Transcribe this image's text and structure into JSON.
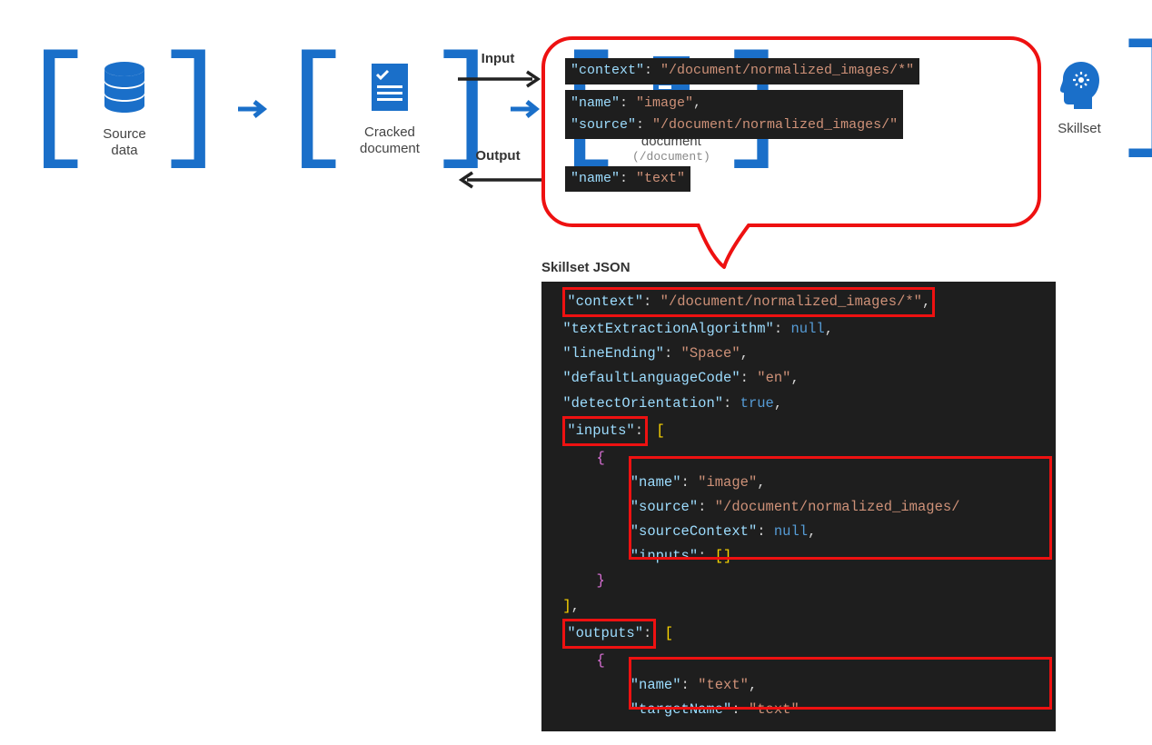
{
  "pipeline": {
    "source": {
      "label": "Source\ndata"
    },
    "cracked": {
      "label": "Cracked\ndocument"
    },
    "enriched": {
      "label": "Enriched\ndocument",
      "sublabel": "(/document)"
    },
    "skillset": {
      "label": "Skillset"
    }
  },
  "io": {
    "input": "Input",
    "output": "Output"
  },
  "bubble": {
    "line1": "\"context\": \"/document/normalized_images/*\"",
    "line2a": "\"name\": \"image\",",
    "line2b": "\"source\": \"/document/normalized_images/\"",
    "line3": "\"name\": \"text\""
  },
  "jsonTitle": "Skillset JSON",
  "json": {
    "context_key": "\"context\"",
    "context_val": "\"/document/normalized_images/*\"",
    "tea_key": "\"textExtractionAlgorithm\"",
    "tea_val": "null",
    "le_key": "\"lineEnding\"",
    "le_val": "\"Space\"",
    "dlc_key": "\"defaultLanguageCode\"",
    "dlc_val": "\"en\"",
    "do_key": "\"detectOrientation\"",
    "do_val": "true",
    "inputs_key": "\"inputs\"",
    "in_name_key": "\"name\"",
    "in_name_val": "\"image\"",
    "in_src_key": "\"source\"",
    "in_src_val": "\"/document/normalized_images/",
    "in_sc_key": "\"sourceContext\"",
    "in_sc_val": "null",
    "in_inputs_key": "\"inputs\"",
    "outputs_key": "\"outputs\"",
    "out_name_key": "\"name\"",
    "out_name_val": "\"text\"",
    "out_tn_key": "\"targetName\"",
    "out_tn_val": "\"text\""
  }
}
